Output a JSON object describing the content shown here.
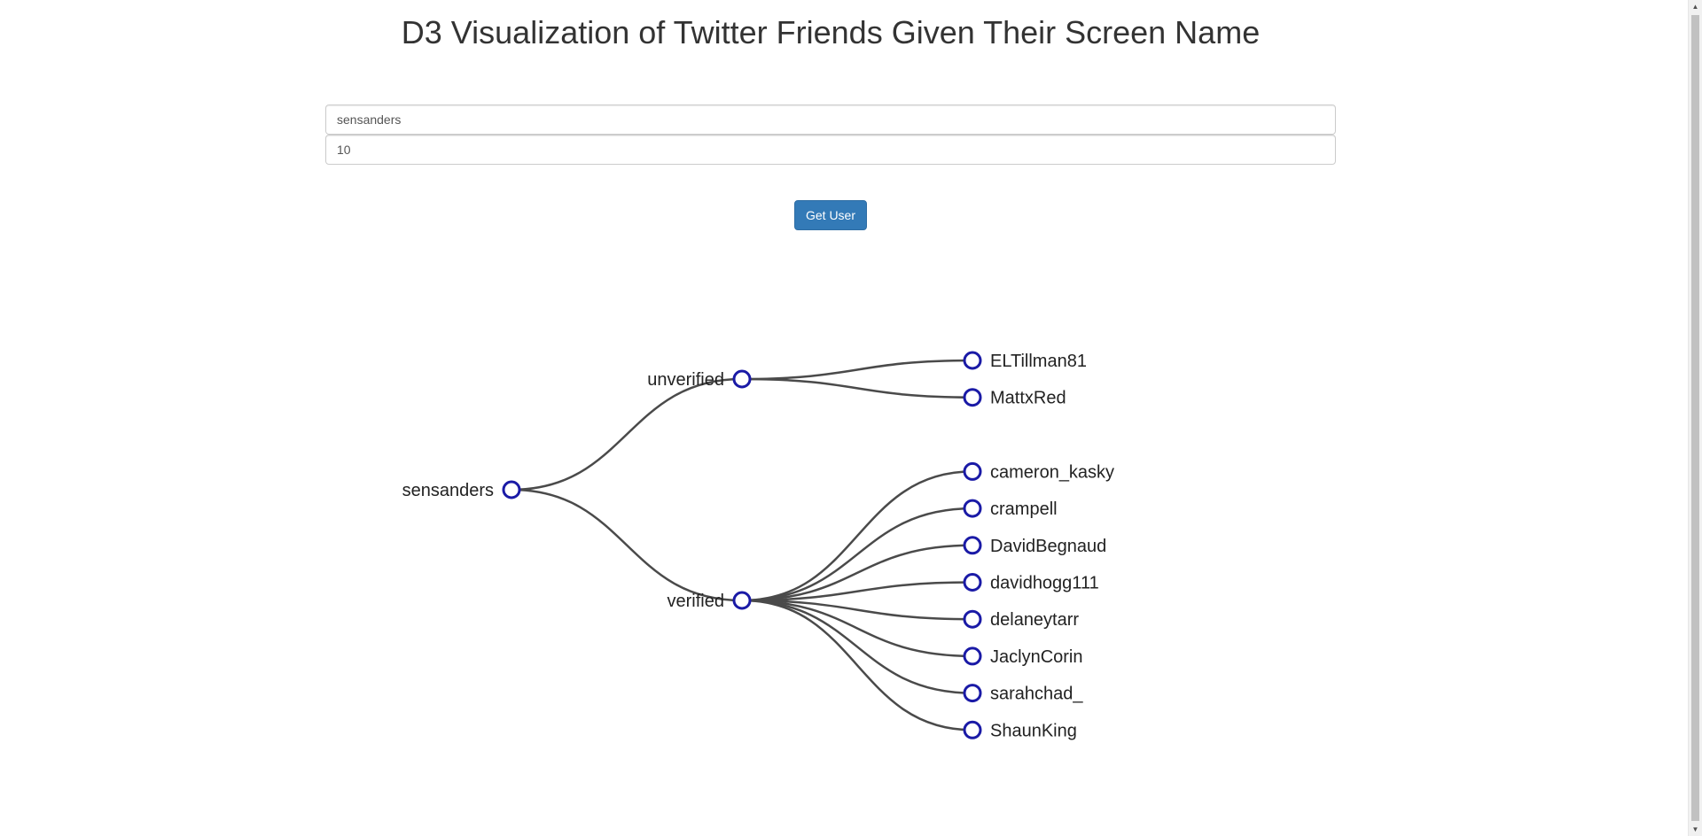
{
  "page": {
    "title": "D3 Visualization of Twitter Friends Given Their Screen Name"
  },
  "form": {
    "screen_name_value": "sensanders",
    "count_value": "10",
    "submit_label": "Get User"
  },
  "colors": {
    "node_stroke": "#1a1aa6",
    "link_stroke": "#4a4a4a",
    "button_bg": "#337ab7"
  },
  "tree": {
    "root": "sensanders",
    "groups": [
      {
        "label": "unverified",
        "friends": [
          "ELTillman81",
          "MattxRed"
        ]
      },
      {
        "label": "verified",
        "friends": [
          "cameron_kasky",
          "crampell",
          "DavidBegnaud",
          "davidhogg111",
          "delaneytarr",
          "JaclynCorin",
          "sarahchad_",
          "ShaunKing"
        ]
      }
    ]
  }
}
